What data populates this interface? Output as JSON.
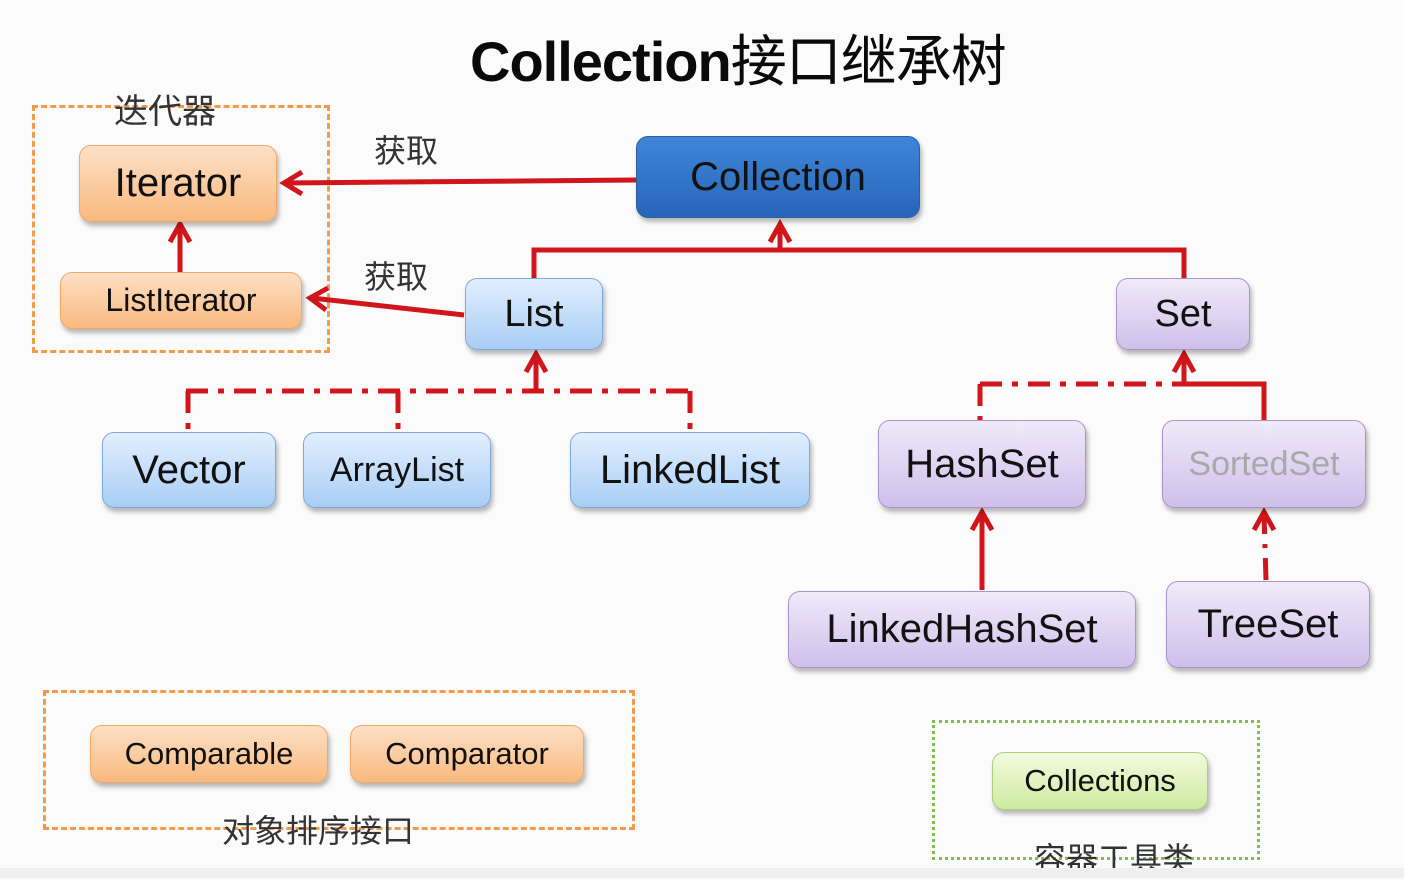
{
  "title": {
    "latin": "Collection",
    "cn": "接口继承树"
  },
  "groups": {
    "iterators": "迭代器",
    "sorting": "对象排序接口",
    "utilities": "容器工具类"
  },
  "edge_labels": {
    "collection_get": "获取",
    "list_get": "获取"
  },
  "nodes": {
    "collection": "Collection",
    "iterator": "Iterator",
    "list_iterator": "ListIterator",
    "list": "List",
    "set": "Set",
    "vector": "Vector",
    "array_list": "ArrayList",
    "linked_list": "LinkedList",
    "hash_set": "HashSet",
    "sorted_set": "SortedSet",
    "linked_hash_set": "LinkedHashSet",
    "tree_set": "TreeSet",
    "comparable": "Comparable",
    "comparator": "Comparator",
    "collections": "Collections"
  },
  "colors": {
    "arrow": "#d0161b",
    "interface_root": "#2f74c8",
    "iterator_group": "#f39b4c",
    "utility_group": "#7fc04a"
  }
}
